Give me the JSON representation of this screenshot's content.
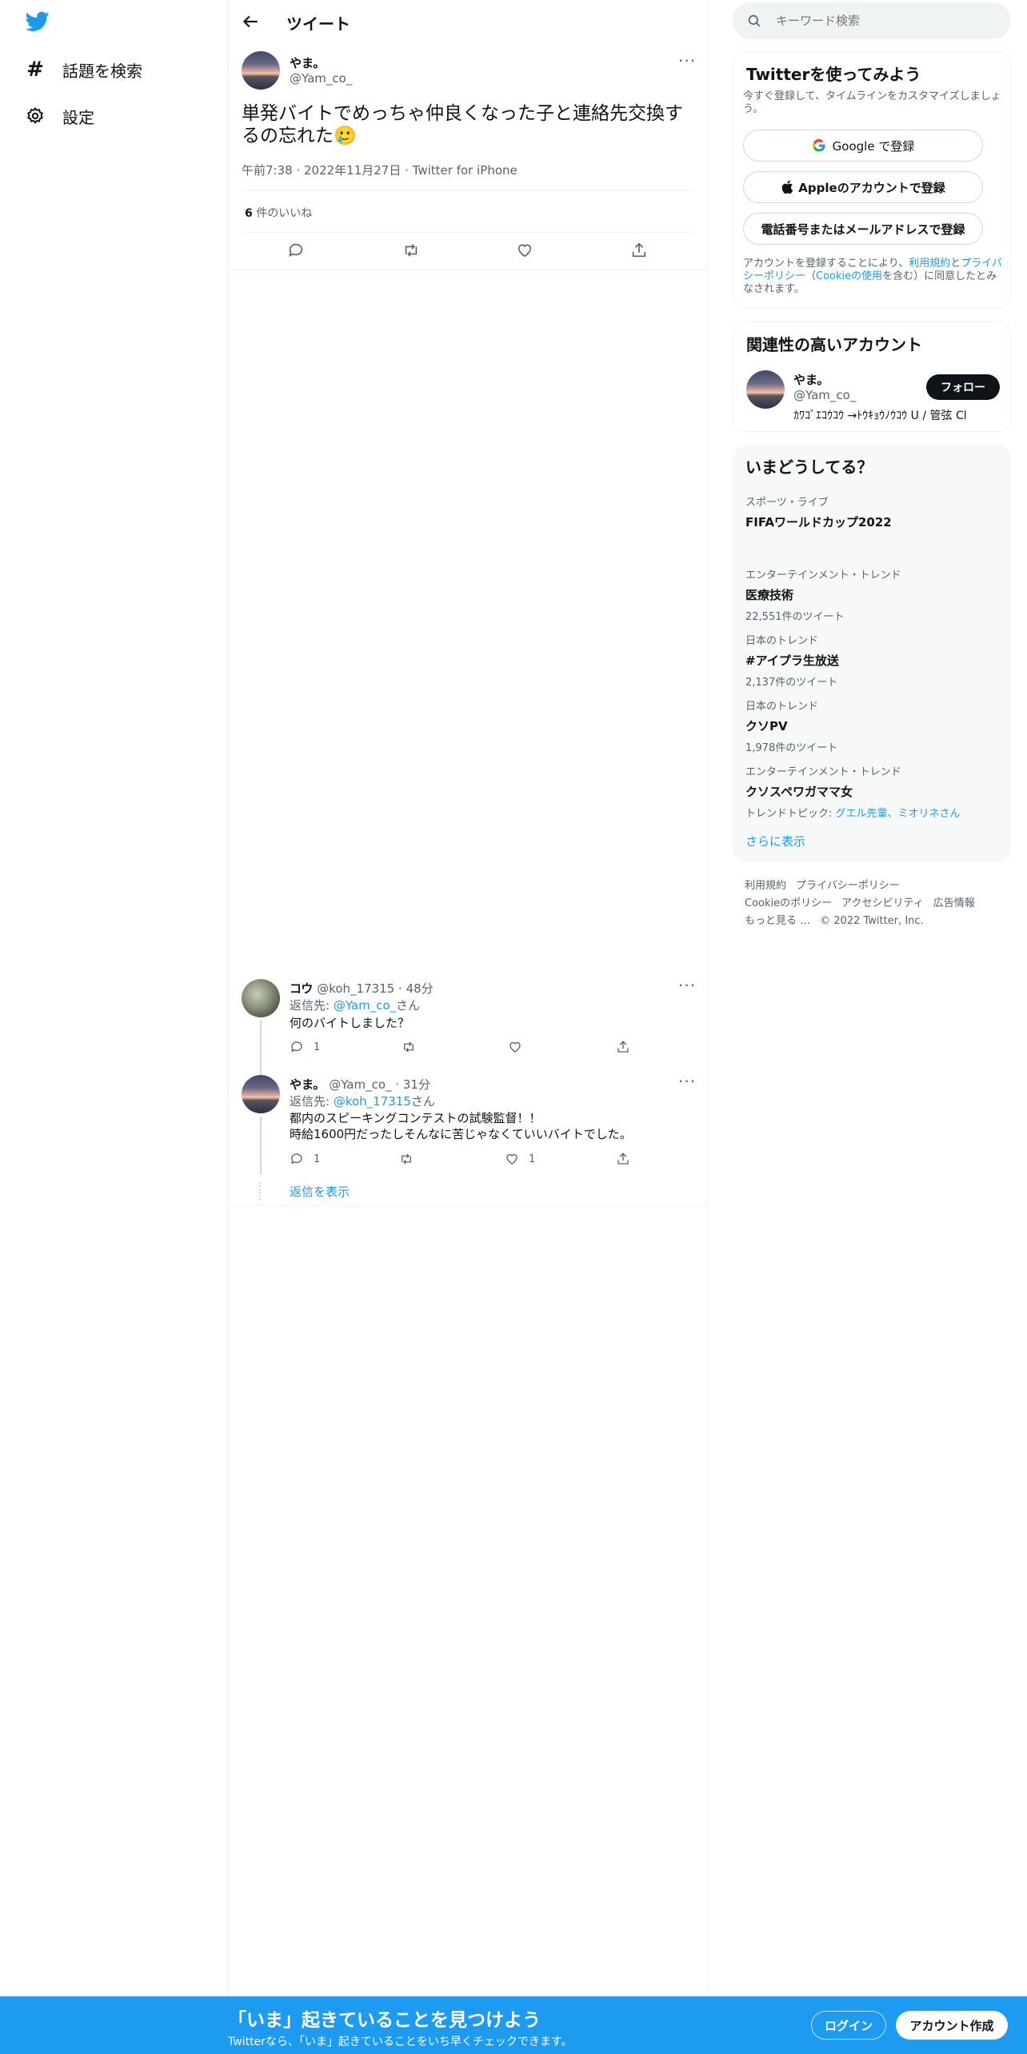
{
  "nav": {
    "explore_label": "話題を検索",
    "settings_label": "設定"
  },
  "header": {
    "title": "ツイート"
  },
  "tweet": {
    "display_name": "やま。",
    "handle": "@Yam_co_",
    "text": "単発バイトでめっちゃ仲良くなった子と連絡先交換するの忘れた",
    "emoji": "🥲",
    "time": "午前7:38",
    "date": "2022年11月27日",
    "source": "Twitter for iPhone",
    "likes_count": "6",
    "likes_label": "件のいいね"
  },
  "replies": [
    {
      "display_name": "コウ",
      "handle": "@koh_17315",
      "time": "48分",
      "reply_prefix": "返信先: ",
      "reply_to": "@Yam_co_",
      "reply_suffix": "さん",
      "text_lines": [
        "何のバイトしました？"
      ],
      "reply_count": "1",
      "retweet_count": "",
      "like_count": ""
    },
    {
      "display_name": "やま。",
      "handle": "@Yam_co_",
      "time": "31分",
      "reply_prefix": "返信先: ",
      "reply_to": "@koh_17315",
      "reply_suffix": "さん",
      "text_lines": [
        "都内のスピーキングコンテストの試験監督！！",
        "時給1600円だったしそんなに苦じゃなくていいバイトでした。"
      ],
      "reply_count": "1",
      "retweet_count": "",
      "like_count": "1"
    }
  ],
  "show_replies_label": "返信を表示",
  "search": {
    "placeholder": "キーワード検索"
  },
  "signup": {
    "title": "Twitterを使ってみよう",
    "subtitle": "今すぐ登録して、タイムラインをカスタマイズしましょう。",
    "google_label": "Google で登録",
    "apple_label": "Appleのアカウントで登録",
    "phone_label": "電話番号またはメールアドレスで登録",
    "terms_pre": "アカウントを登録することにより、",
    "terms_link": "利用規約",
    "terms_and": "と",
    "privacy_link": "プライバシーポリシー",
    "cookie_open": "（",
    "cookie_link": "Cookieの使用",
    "terms_post": "を含む）に同意したとみなされます。"
  },
  "related": {
    "title": "関連性の高いアカウント",
    "display_name": "やま。",
    "handle": "@Yam_co_",
    "follow_label": "フォロー",
    "bio": "ｶﾜｺﾞｴｺｳｺｳ →ﾄｳｷｮｳﾉｳｺｳ U / 管弦 Cl"
  },
  "trends": {
    "title": "いまどうしてる？",
    "items": [
      {
        "category": "スポーツ・ライブ",
        "name": "FIFAワールドカップ2022",
        "count": ""
      },
      {
        "category": "エンターテインメント・トレンド",
        "name": "医療技術",
        "count": "22,551件のツイート"
      },
      {
        "category": "日本のトレンド",
        "name": "#アイプラ生放送",
        "count": "2,137件のツイート"
      },
      {
        "category": "日本のトレンド",
        "name": "クソPV",
        "count": "1,978件のツイート"
      },
      {
        "category": "エンターテインメント・トレンド",
        "name": "クソスペワガママ女",
        "count": ""
      }
    ],
    "last_topics_prefix": "トレンドトピック: ",
    "last_topics": "グエル先輩、ミオリネさん",
    "show_more": "さらに表示"
  },
  "footer": {
    "terms": "利用規約",
    "privacy": "プライバシーポリシー",
    "cookie": "Cookieのポリシー",
    "accessibility": "アクセシビリティ",
    "ads": "広告情報",
    "more": "もっと見る …",
    "copyright": "© 2022 Twitter, Inc."
  },
  "bottom_bar": {
    "headline": "「いま」起きていることを見つけよう",
    "sub": "Twitterなら、「いま」起きていることをいち早くチェックできます。",
    "login_label": "ログイン",
    "signup_label": "アカウント作成"
  },
  "colors": {
    "accent": "#1d9bf0",
    "text": "#0f1419",
    "secondary": "#536471",
    "border": "#eff3f4"
  }
}
